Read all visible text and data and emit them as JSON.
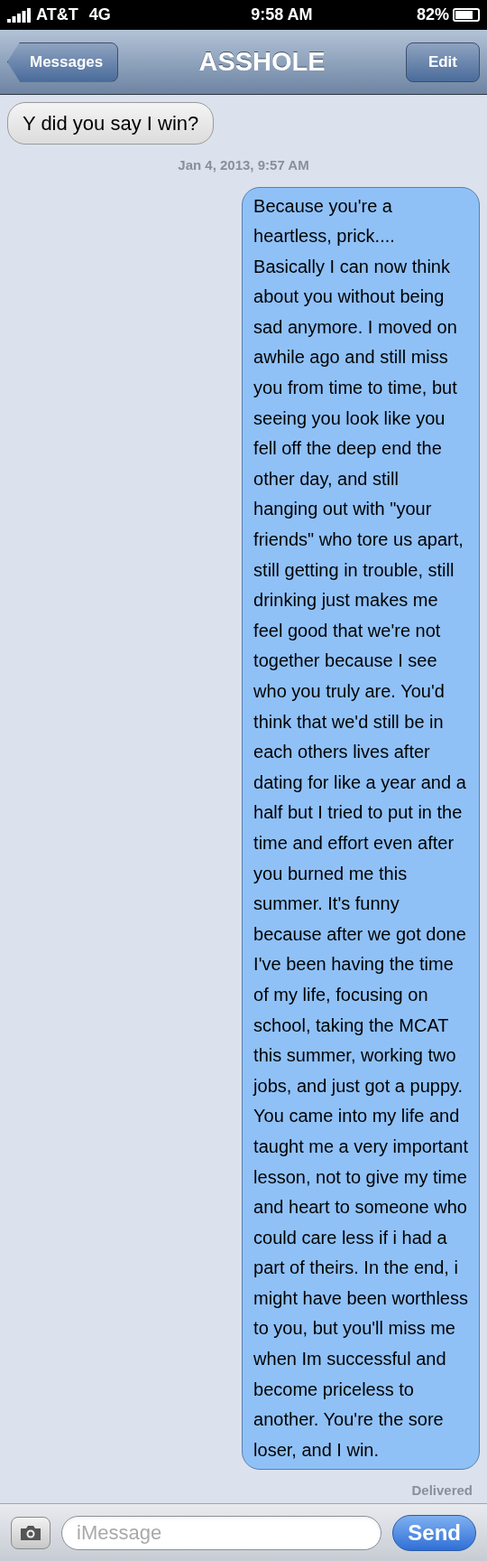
{
  "status_bar": {
    "carrier": "AT&T",
    "network": "4G",
    "time": "9:58 AM",
    "battery": "82%"
  },
  "nav": {
    "back": "Messages",
    "title": "ASSHOLE",
    "edit": "Edit"
  },
  "messages": [
    {
      "kind": "received",
      "text": "Y did you say I win?"
    },
    {
      "kind": "timestamp",
      "text": "Jan 4, 2013, 9:57 AM"
    },
    {
      "kind": "sent",
      "text": "Because you're a\nheartless, prick....\nBasically I can now think\nabout you without being\nsad anymore. I moved on\nawhile ago and still miss\nyou from time to time, but\nseeing you look like you\nfell off the deep end the\nother day, and still\nhanging out with \"your\nfriends\" who tore us apart,\nstill getting in trouble, still\ndrinking just makes me\nfeel good that we're not\ntogether because I see\nwho you truly are. You'd\nthink that we'd still be in\neach others lives after\ndating for like a year and a\nhalf but I tried to put in the\ntime and effort even after\nyou burned me this\nsummer. It's funny\nbecause after we got done\nI've been having the time\nof my life, focusing on\nschool, taking the MCAT\nthis summer, working two\njobs, and just got a puppy.\nYou came into my life and\ntaught me a very important\nlesson, not to give my time\nand heart to someone who\ncould care less if i had a\npart of theirs. In the end, i\nmight have been worthless\nto you, but you'll miss me\nwhen Im successful and\nbecome priceless to\nanother. You're the sore\nloser, and I win."
    },
    {
      "kind": "status",
      "text": "Delivered"
    }
  ],
  "compose": {
    "placeholder": "iMessage",
    "send": "Send"
  }
}
